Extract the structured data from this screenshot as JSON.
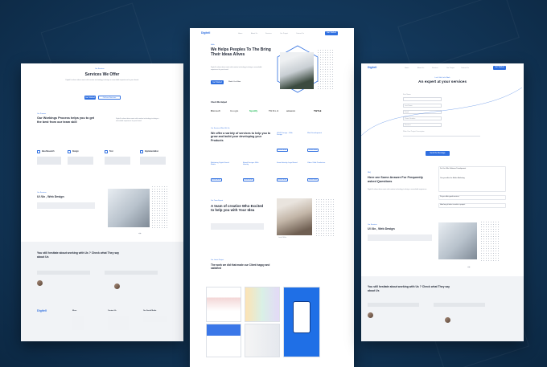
{
  "brand": "Digitell",
  "nav": [
    "Home",
    "About Us",
    "Services",
    "Our Project",
    "Contact Us"
  ],
  "nav_button": "Get Started",
  "left_page": {
    "services_kicker": "Our Services",
    "services_title": "Services We Offer",
    "services_body": "Digitell is where ideas meet with creative technology to design a remarkable experience for your brand.",
    "btn_primary": "Get Started",
    "btn_secondary": "Call our Services",
    "process_kicker": "Our Process",
    "process_title": "Our Workings Process helps you to get the best from our team skill",
    "steps": [
      "Idea Research",
      "Design",
      "Test",
      "Implementation"
    ],
    "portfolio_kicker": "Our Services",
    "portfolio_title": "UI /Ux , Web Design",
    "testimonial_title": "You still hesitate about working with Us ? Check what They say about Us",
    "footer_cols": [
      "Menu",
      "Contact Us",
      "Our Social Media"
    ]
  },
  "center_page": {
    "hero_kicker": "Hello",
    "hero_title": "We Helps Peoples To The Bring Their Ideas Alives",
    "hero_body": "Digitell is where ideas meet with creative technology to design a remarkable experience for your brand.",
    "hero_btn": "Get Started",
    "hero_link": "Watch Our Video",
    "clients_title": "Check We Helped",
    "clients": [
      "Microsoft",
      "Google",
      "Spotify",
      "TESLA",
      "amazon",
      "TikTok"
    ],
    "services_kicker": "Our Services What We Do",
    "services_title": "We offer a variety of services to help you to grow and build your developing your Products",
    "service_cards": [
      "UI/UX Design - Web Design",
      "Web Development",
      "Marketing Digital Social Media",
      "Brand Designs With Identity",
      "Smart Identity Logo Brand",
      "Video / Edit Production"
    ],
    "team_kicker": "Our Team Expert",
    "team_title": "A team of creative Who Excited to help you with Your Idea",
    "work_kicker": "Our Latest Project",
    "work_title": "The work we did that made our Client happy and satisfied"
  },
  "right_page": {
    "contact_kicker": "Let's Talk, Let's Work",
    "contact_title": "An expert at your services",
    "fields": [
      "First Name",
      "Last Name",
      "Email",
      "Phone Number",
      "Services",
      "Write Your Project Description"
    ],
    "submit": "Send the Message",
    "faq_kicker": "FAQ",
    "faq_title": "Here are Some Answer For Frequently asked Questions",
    "faq_items": [
      "Do You Offer Software Development",
      "Can you offer the Media Marketing",
      "Do you offer good services",
      "How long it takes to make a project"
    ],
    "portfolio_kicker": "Our Services",
    "portfolio_title": "UI /Ux , Web Design",
    "testimonial_title": "You still hesitate about working with Us ? Check what They say about Us"
  },
  "colors": {
    "accent": "#2f6fe0",
    "background": "#143a5e"
  }
}
